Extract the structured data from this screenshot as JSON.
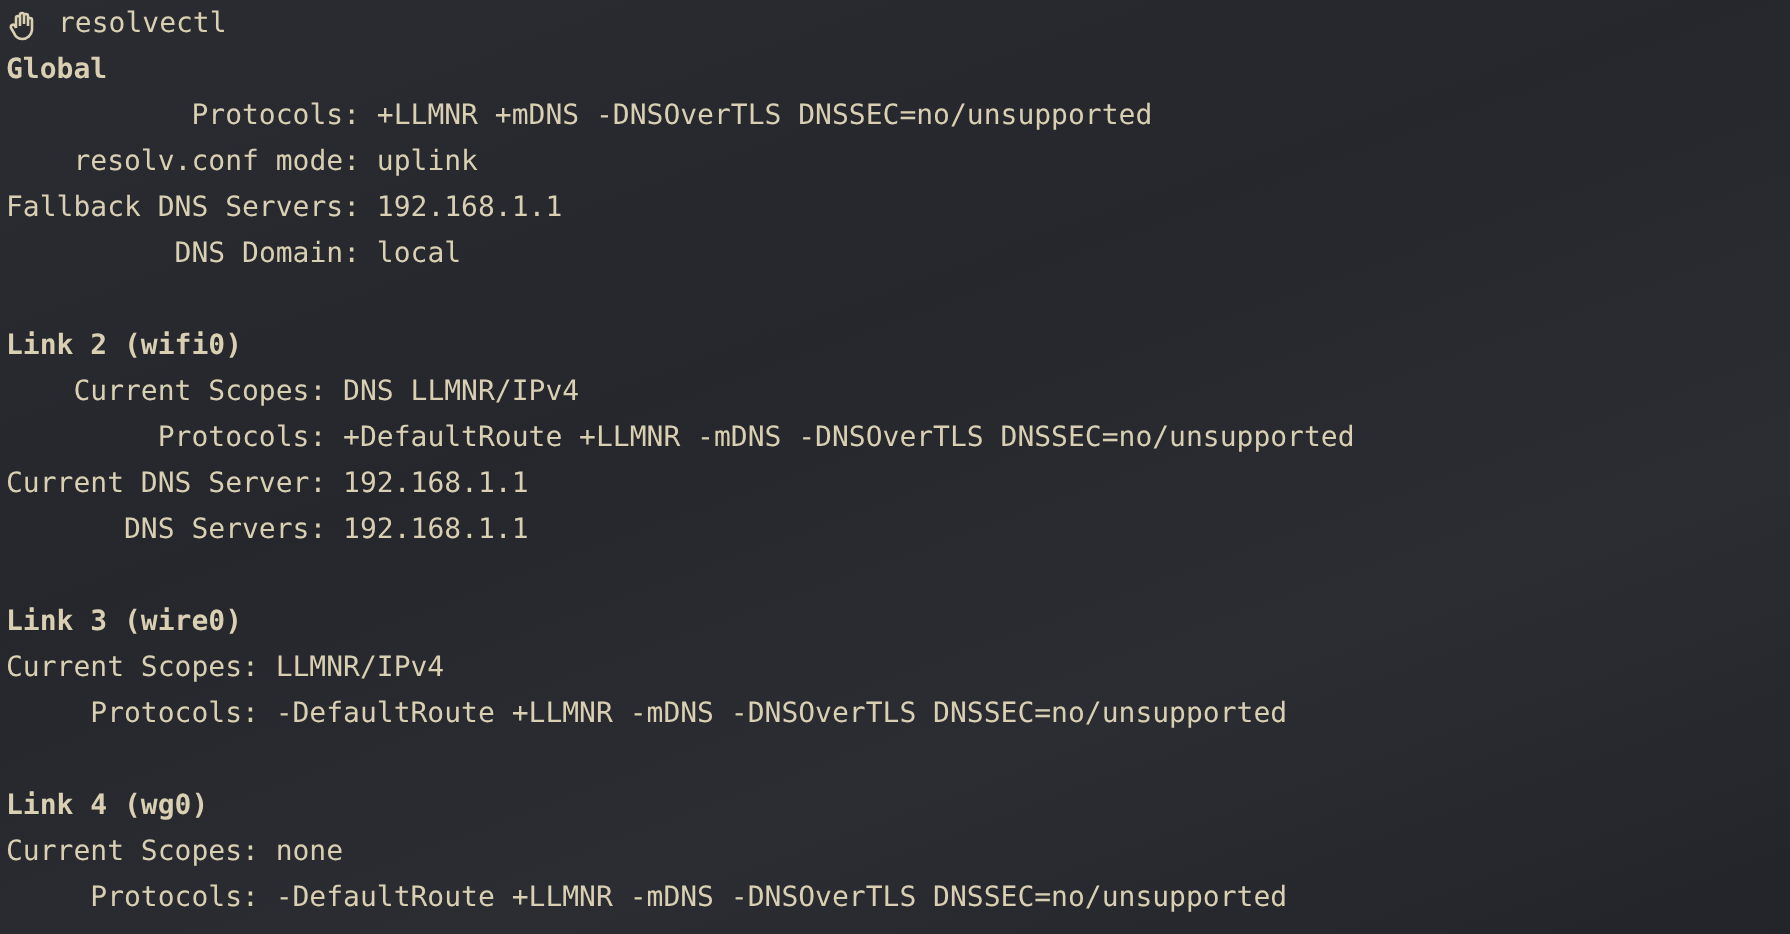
{
  "prompt": {
    "command": "resolvectl"
  },
  "sections": [
    {
      "title": "Global",
      "rows": [
        {
          "label": "Protocols:",
          "value": "+LLMNR +mDNS -DNSOverTLS DNSSEC=no/unsupported"
        },
        {
          "label": "resolv.conf mode:",
          "value": "uplink"
        },
        {
          "label": "Fallback DNS Servers:",
          "value": "192.168.1.1"
        },
        {
          "label": "DNS Domain:",
          "value": "local"
        }
      ]
    },
    {
      "title": "Link 2 (wifi0)",
      "rows": [
        {
          "label": "Current Scopes:",
          "value": "DNS LLMNR/IPv4"
        },
        {
          "label": "Protocols:",
          "value": "+DefaultRoute +LLMNR -mDNS -DNSOverTLS DNSSEC=no/unsupported"
        },
        {
          "label": "Current DNS Server:",
          "value": "192.168.1.1"
        },
        {
          "label": "DNS Servers:",
          "value": "192.168.1.1"
        }
      ]
    },
    {
      "title": "Link 3 (wire0)",
      "rows": [
        {
          "label": "Current Scopes:",
          "value": "LLMNR/IPv4"
        },
        {
          "label": "Protocols:",
          "value": "-DefaultRoute +LLMNR -mDNS -DNSOverTLS DNSSEC=no/unsupported"
        }
      ]
    },
    {
      "title": "Link 4 (wg0)",
      "rows": [
        {
          "label": "Current Scopes:",
          "value": "none"
        },
        {
          "label": "Protocols:",
          "value": "-DefaultRoute +LLMNR -mDNS -DNSOverTLS DNSSEC=no/unsupported"
        }
      ]
    }
  ]
}
